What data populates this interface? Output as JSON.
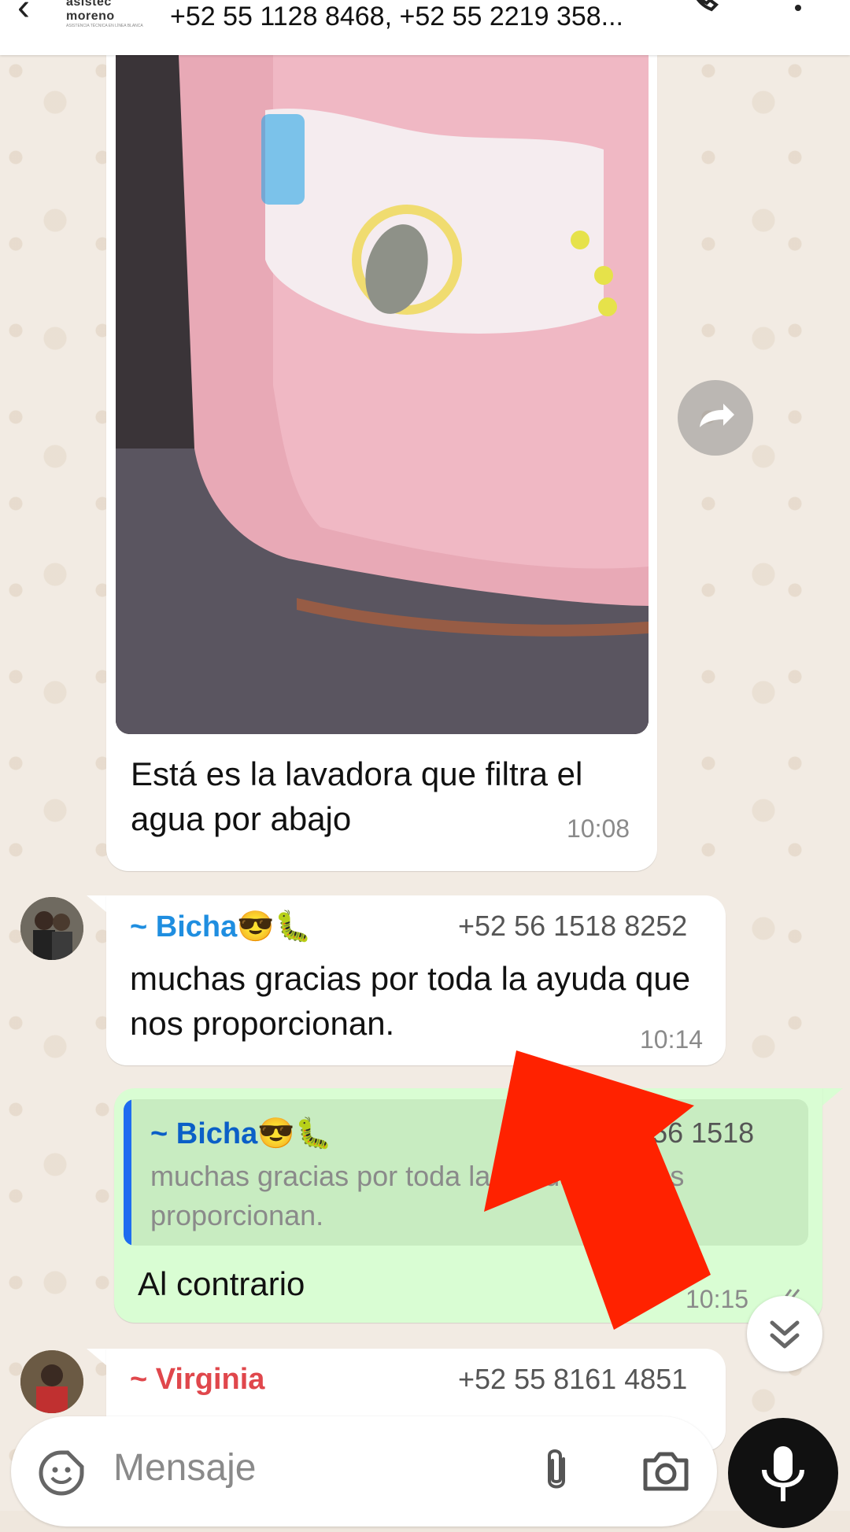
{
  "header": {
    "logo_text": "asistec moreno",
    "logo_tagline": "ASISTENCIA TÉCNICA EN LÍNEA BLANCA",
    "members": "+52 55 1128 8468, +52 55 2219 358..."
  },
  "messages": {
    "image_msg": {
      "caption": "Está es la lavadora que filtra el agua por abajo",
      "time": "10:08"
    },
    "bicha_msg": {
      "sender": "~ Bicha😎🐛",
      "phone": "+52 56 1518 8252",
      "text": "muchas gracias por toda la ayuda que nos proporcionan.",
      "time": "10:14"
    },
    "reply_msg": {
      "quote_sender": "~ Bicha😎🐛",
      "quote_phone": "+52 56 1518 8252",
      "quote_text": "muchas gracias por toda la ayuda que nos proporcionan.",
      "text": "Al contrario",
      "time": "10:15"
    },
    "virginia_msg": {
      "sender": "~ Virginia",
      "phone": "+52 55 8161 4851"
    }
  },
  "input": {
    "placeholder": "Mensaje"
  },
  "colors": {
    "bicha_name": "#1f8ee0",
    "quote_name": "#0b5fc7",
    "virginia_name": "#e0474c",
    "outgoing_bubble": "#d9fdd3",
    "annotation_arrow": "#ff2200"
  },
  "icons": [
    "back-arrow-icon",
    "call-icon",
    "menu-icon",
    "forward-icon",
    "double-check-icon",
    "double-chevron-down-icon",
    "sticker-icon",
    "attach-icon",
    "camera-icon",
    "mic-icon"
  ]
}
